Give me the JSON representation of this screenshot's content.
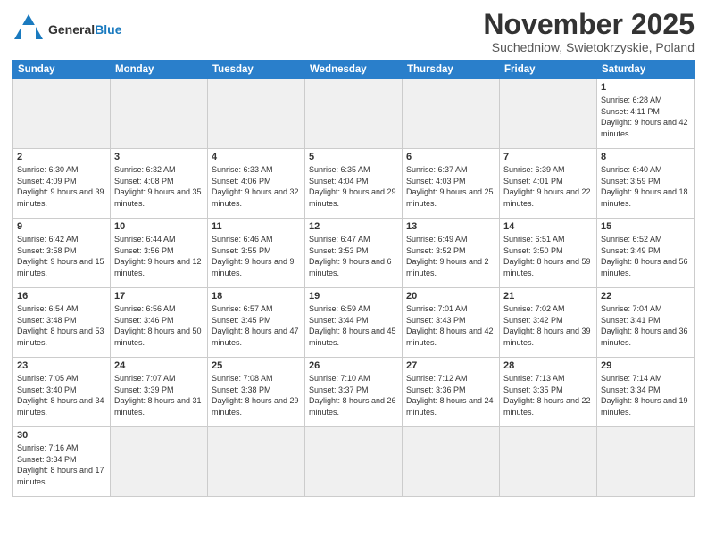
{
  "logo": {
    "text_general": "General",
    "text_blue": "Blue"
  },
  "header": {
    "month": "November 2025",
    "location": "Suchedniow, Swietokrzyskie, Poland"
  },
  "weekdays": [
    "Sunday",
    "Monday",
    "Tuesday",
    "Wednesday",
    "Thursday",
    "Friday",
    "Saturday"
  ],
  "weeks": [
    [
      {
        "date": "",
        "info": ""
      },
      {
        "date": "",
        "info": ""
      },
      {
        "date": "",
        "info": ""
      },
      {
        "date": "",
        "info": ""
      },
      {
        "date": "",
        "info": ""
      },
      {
        "date": "",
        "info": ""
      },
      {
        "date": "1",
        "info": "Sunrise: 6:28 AM\nSunset: 4:11 PM\nDaylight: 9 hours and 42 minutes."
      }
    ],
    [
      {
        "date": "2",
        "info": "Sunrise: 6:30 AM\nSunset: 4:09 PM\nDaylight: 9 hours and 39 minutes."
      },
      {
        "date": "3",
        "info": "Sunrise: 6:32 AM\nSunset: 4:08 PM\nDaylight: 9 hours and 35 minutes."
      },
      {
        "date": "4",
        "info": "Sunrise: 6:33 AM\nSunset: 4:06 PM\nDaylight: 9 hours and 32 minutes."
      },
      {
        "date": "5",
        "info": "Sunrise: 6:35 AM\nSunset: 4:04 PM\nDaylight: 9 hours and 29 minutes."
      },
      {
        "date": "6",
        "info": "Sunrise: 6:37 AM\nSunset: 4:03 PM\nDaylight: 9 hours and 25 minutes."
      },
      {
        "date": "7",
        "info": "Sunrise: 6:39 AM\nSunset: 4:01 PM\nDaylight: 9 hours and 22 minutes."
      },
      {
        "date": "8",
        "info": "Sunrise: 6:40 AM\nSunset: 3:59 PM\nDaylight: 9 hours and 18 minutes."
      }
    ],
    [
      {
        "date": "9",
        "info": "Sunrise: 6:42 AM\nSunset: 3:58 PM\nDaylight: 9 hours and 15 minutes."
      },
      {
        "date": "10",
        "info": "Sunrise: 6:44 AM\nSunset: 3:56 PM\nDaylight: 9 hours and 12 minutes."
      },
      {
        "date": "11",
        "info": "Sunrise: 6:46 AM\nSunset: 3:55 PM\nDaylight: 9 hours and 9 minutes."
      },
      {
        "date": "12",
        "info": "Sunrise: 6:47 AM\nSunset: 3:53 PM\nDaylight: 9 hours and 6 minutes."
      },
      {
        "date": "13",
        "info": "Sunrise: 6:49 AM\nSunset: 3:52 PM\nDaylight: 9 hours and 2 minutes."
      },
      {
        "date": "14",
        "info": "Sunrise: 6:51 AM\nSunset: 3:50 PM\nDaylight: 8 hours and 59 minutes."
      },
      {
        "date": "15",
        "info": "Sunrise: 6:52 AM\nSunset: 3:49 PM\nDaylight: 8 hours and 56 minutes."
      }
    ],
    [
      {
        "date": "16",
        "info": "Sunrise: 6:54 AM\nSunset: 3:48 PM\nDaylight: 8 hours and 53 minutes."
      },
      {
        "date": "17",
        "info": "Sunrise: 6:56 AM\nSunset: 3:46 PM\nDaylight: 8 hours and 50 minutes."
      },
      {
        "date": "18",
        "info": "Sunrise: 6:57 AM\nSunset: 3:45 PM\nDaylight: 8 hours and 47 minutes."
      },
      {
        "date": "19",
        "info": "Sunrise: 6:59 AM\nSunset: 3:44 PM\nDaylight: 8 hours and 45 minutes."
      },
      {
        "date": "20",
        "info": "Sunrise: 7:01 AM\nSunset: 3:43 PM\nDaylight: 8 hours and 42 minutes."
      },
      {
        "date": "21",
        "info": "Sunrise: 7:02 AM\nSunset: 3:42 PM\nDaylight: 8 hours and 39 minutes."
      },
      {
        "date": "22",
        "info": "Sunrise: 7:04 AM\nSunset: 3:41 PM\nDaylight: 8 hours and 36 minutes."
      }
    ],
    [
      {
        "date": "23",
        "info": "Sunrise: 7:05 AM\nSunset: 3:40 PM\nDaylight: 8 hours and 34 minutes."
      },
      {
        "date": "24",
        "info": "Sunrise: 7:07 AM\nSunset: 3:39 PM\nDaylight: 8 hours and 31 minutes."
      },
      {
        "date": "25",
        "info": "Sunrise: 7:08 AM\nSunset: 3:38 PM\nDaylight: 8 hours and 29 minutes."
      },
      {
        "date": "26",
        "info": "Sunrise: 7:10 AM\nSunset: 3:37 PM\nDaylight: 8 hours and 26 minutes."
      },
      {
        "date": "27",
        "info": "Sunrise: 7:12 AM\nSunset: 3:36 PM\nDaylight: 8 hours and 24 minutes."
      },
      {
        "date": "28",
        "info": "Sunrise: 7:13 AM\nSunset: 3:35 PM\nDaylight: 8 hours and 22 minutes."
      },
      {
        "date": "29",
        "info": "Sunrise: 7:14 AM\nSunset: 3:34 PM\nDaylight: 8 hours and 19 minutes."
      }
    ],
    [
      {
        "date": "30",
        "info": "Sunrise: 7:16 AM\nSunset: 3:34 PM\nDaylight: 8 hours and 17 minutes."
      },
      {
        "date": "",
        "info": ""
      },
      {
        "date": "",
        "info": ""
      },
      {
        "date": "",
        "info": ""
      },
      {
        "date": "",
        "info": ""
      },
      {
        "date": "",
        "info": ""
      },
      {
        "date": "",
        "info": ""
      }
    ]
  ]
}
